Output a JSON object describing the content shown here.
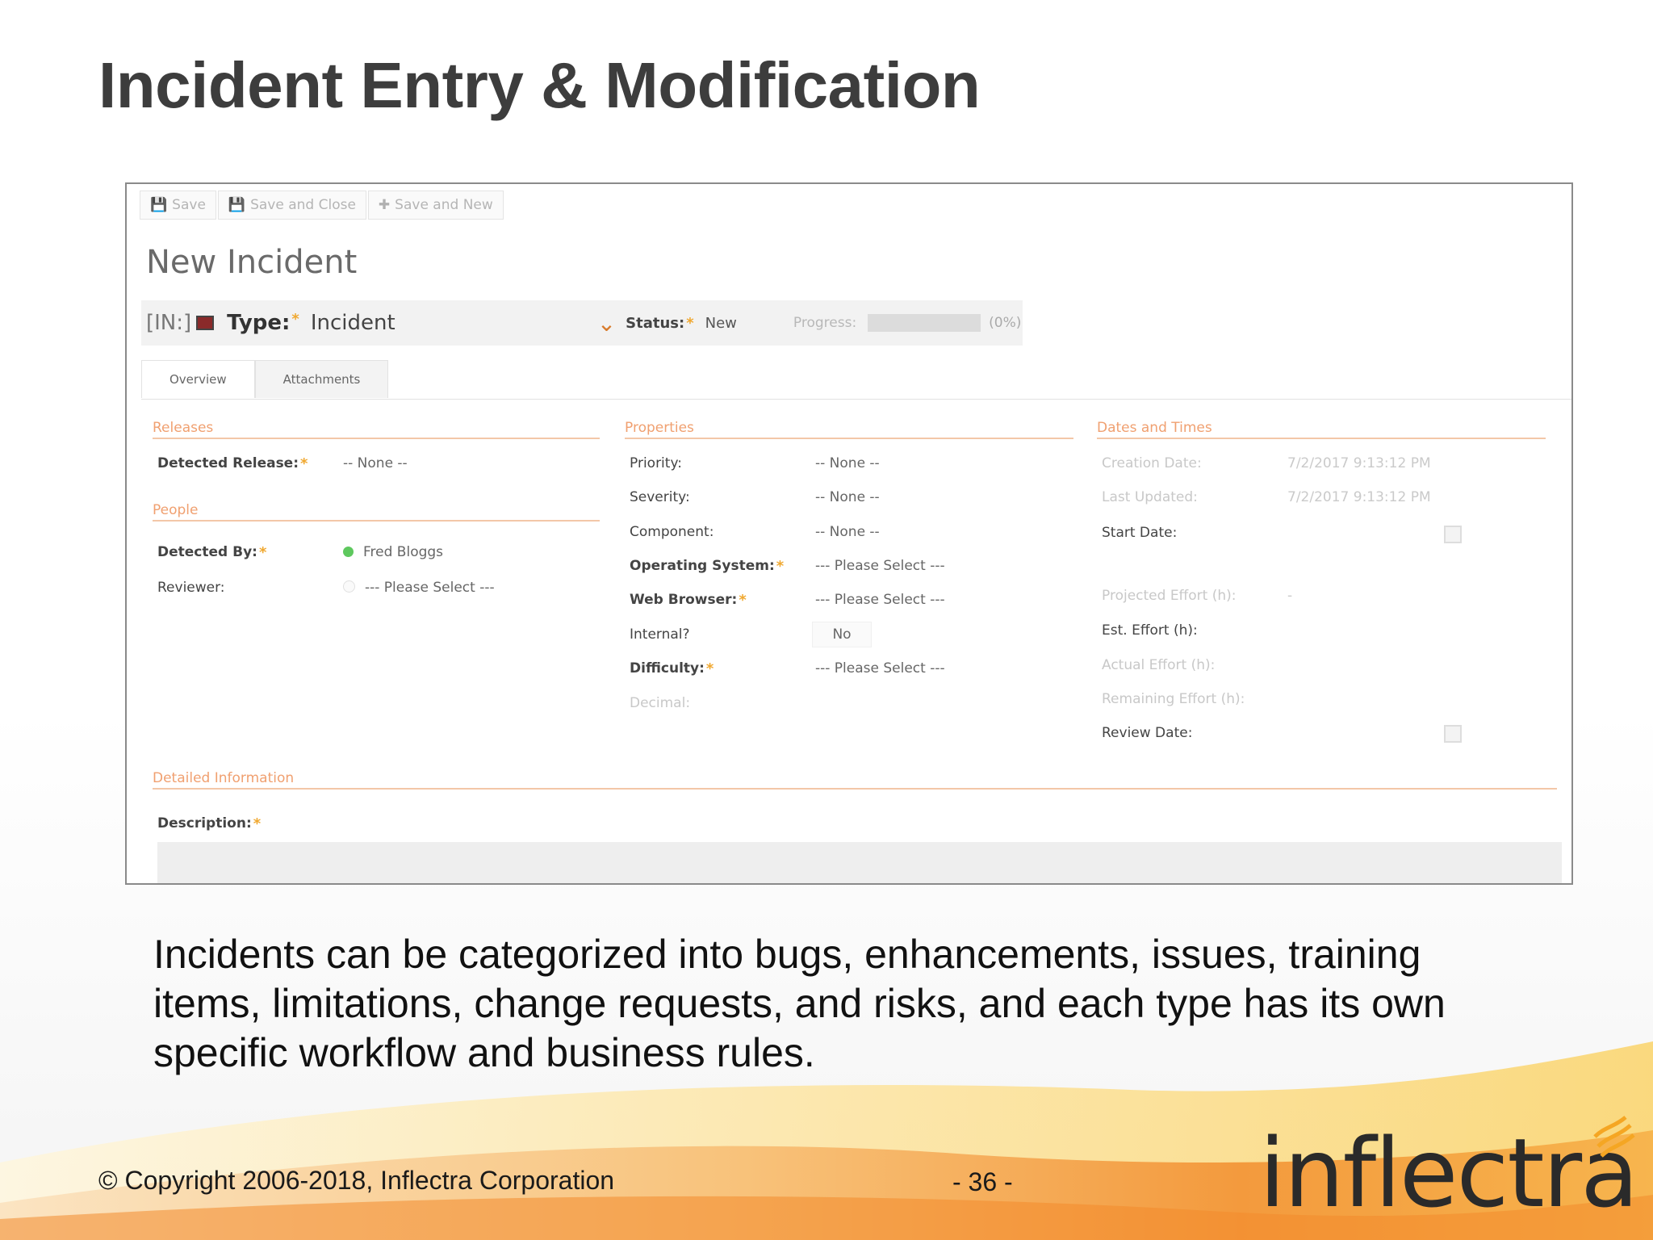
{
  "slide": {
    "title": "Incident Entry & Modification",
    "caption": "Incidents can be categorized into bugs, enhancements, issues, training items, limitations, change requests, and risks, and each type has its own specific workflow and business rules.",
    "copyright": "© Copyright 2006-2018, Inflectra Corporation",
    "page": "- 36 -",
    "logo": "inflectra",
    "colors": {
      "accent": "#f0a070",
      "brand_orange": "#f5a623",
      "title": "#3d3d3d"
    }
  },
  "form": {
    "toolbar": {
      "save": "Save",
      "save_close": "Save and Close",
      "save_new": "Save and New"
    },
    "title": "New Incident",
    "header": {
      "prefix": "[IN:]",
      "type_label": "Type:",
      "type_value": "Incident",
      "status_label": "Status:",
      "status_value": "New",
      "progress_label": "Progress:",
      "progress_pct": "(0%)",
      "progress_fraction": 0
    },
    "tabs": [
      "Overview",
      "Attachments"
    ],
    "releases": {
      "heading": "Releases",
      "detected_release_label": "Detected Release:",
      "detected_release_value": "-- None --"
    },
    "people": {
      "heading": "People",
      "detected_by_label": "Detected By:",
      "detected_by_value": "Fred Bloggs",
      "reviewer_label": "Reviewer:",
      "reviewer_value": "--- Please Select ---"
    },
    "properties": {
      "heading": "Properties",
      "rows": [
        {
          "label": "Priority:",
          "value": "-- None --"
        },
        {
          "label": "Severity:",
          "value": "-- None --"
        },
        {
          "label": "Component:",
          "value": "-- None --"
        },
        {
          "label": "Operating System:",
          "value": "--- Please Select ---"
        },
        {
          "label": "Web Browser:",
          "value": "--- Please Select ---"
        },
        {
          "label": "Internal?",
          "value": "No"
        },
        {
          "label": "Difficulty:",
          "value": "--- Please Select ---"
        },
        {
          "label": "Decimal:",
          "value": ""
        }
      ]
    },
    "dates": {
      "heading": "Dates and Times",
      "creation_label": "Creation Date:",
      "creation_value": "7/2/2017 9:13:12 PM",
      "updated_label": "Last Updated:",
      "updated_value": "7/2/2017 9:13:12 PM",
      "start_label": "Start Date:",
      "projected_label": "Projected Effort (h):",
      "projected_value": "-",
      "est_label": "Est. Effort (h):",
      "actual_label": "Actual Effort (h):",
      "remaining_label": "Remaining Effort (h):",
      "review_label": "Review Date:"
    },
    "detailed": {
      "heading": "Detailed Information",
      "description_label": "Description:"
    }
  }
}
